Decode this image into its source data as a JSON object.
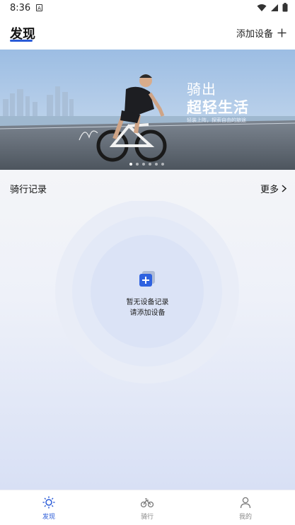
{
  "status_bar": {
    "time": "8:36",
    "badge": "A"
  },
  "header": {
    "title": "发现",
    "add_device_label": "添加设备"
  },
  "banner": {
    "headline_line1": "骑出",
    "headline_line2": "超轻生活",
    "subline": "轻装上阵，探索自由的旅途",
    "slide_count": 6,
    "active_slide": 1
  },
  "records": {
    "title": "骑行记录",
    "more_label": "更多"
  },
  "empty_state": {
    "line1": "暂无设备记录",
    "line2": "请添加设备"
  },
  "tabbar": {
    "items": [
      {
        "label": "发现",
        "icon": "sun-icon",
        "active": true
      },
      {
        "label": "骑行",
        "icon": "bike-icon",
        "active": false
      },
      {
        "label": "我的",
        "icon": "person-icon",
        "active": false
      }
    ]
  },
  "colors": {
    "accent": "#2a5bd7",
    "banner_sky": "#8fb3dc",
    "road": "#5d6670"
  }
}
